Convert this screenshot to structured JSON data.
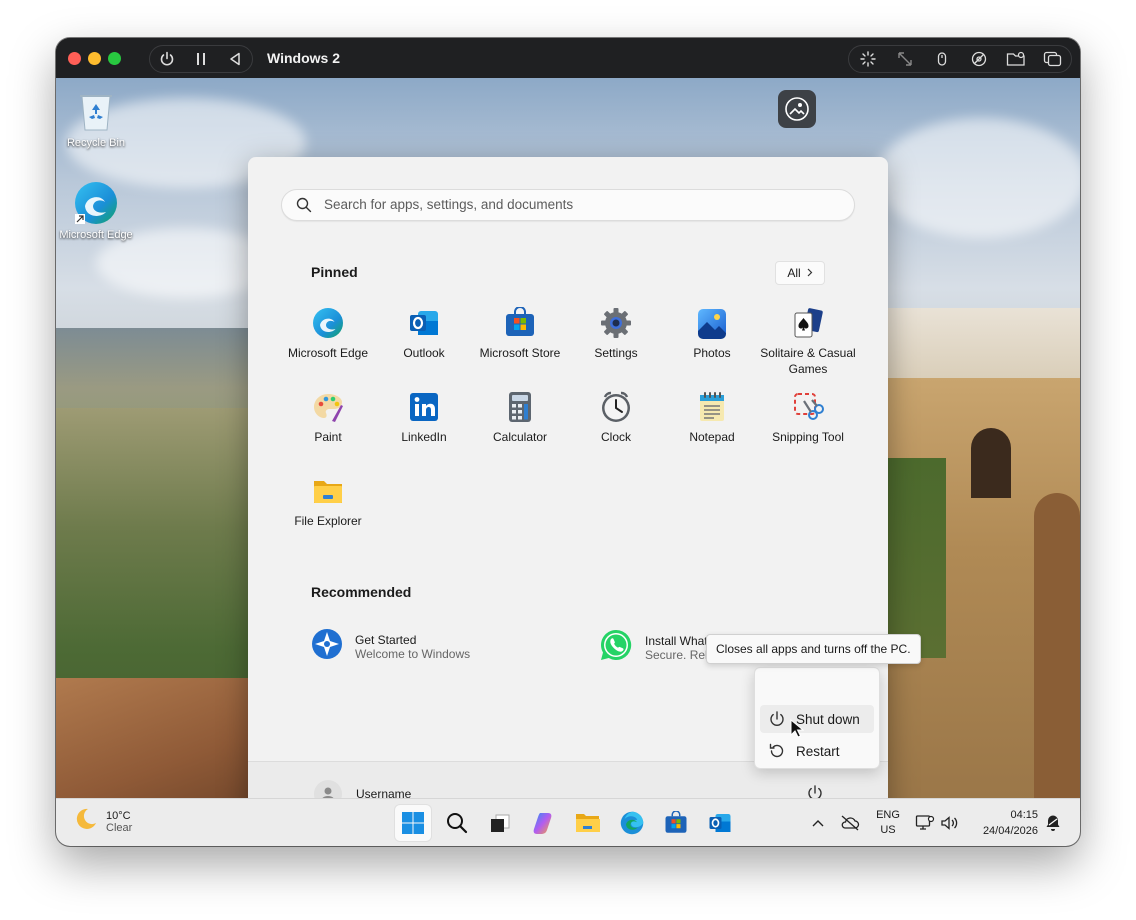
{
  "vm": {
    "title": "Windows 2",
    "toolbar_icons": [
      "power-icon",
      "pause-icon",
      "back-icon"
    ],
    "right_icons": [
      "spinner-icon",
      "resize-icon",
      "mouse-icon",
      "disc-icon",
      "folder-icon",
      "windows-icon"
    ]
  },
  "desktop": {
    "icons": [
      {
        "label": "Recycle Bin"
      },
      {
        "label": "Microsoft Edge"
      }
    ]
  },
  "start_menu": {
    "search": {
      "placeholder": "Search for apps, settings, and documents"
    },
    "pinned_title": "Pinned",
    "all_label": "All",
    "pinned_apps": [
      {
        "label": "Microsoft Edge"
      },
      {
        "label": "Outlook"
      },
      {
        "label": "Microsoft Store"
      },
      {
        "label": "Settings"
      },
      {
        "label": "Photos"
      },
      {
        "label": "Solitaire & Casual Games"
      },
      {
        "label": "Paint"
      },
      {
        "label": "LinkedIn"
      },
      {
        "label": "Calculator"
      },
      {
        "label": "Clock"
      },
      {
        "label": "Notepad"
      },
      {
        "label": "Snipping Tool"
      },
      {
        "label": "File Explorer"
      }
    ],
    "recommended_title": "Recommended",
    "recommended": [
      {
        "title": "Get Started",
        "subtitle": "Welcome to Windows"
      },
      {
        "title": "Install WhatsApp",
        "subtitle": "Secure. Reliable. Private."
      }
    ],
    "username": "Username",
    "power_menu": {
      "tooltip": "Closes all apps and turns off the PC.",
      "shutdown": "Shut down",
      "restart": "Restart"
    }
  },
  "taskbar": {
    "weather": {
      "temp": "10°C",
      "condition": "Clear"
    },
    "language": {
      "lang": "ENG",
      "region": "US"
    },
    "time": "04:15",
    "date": "24/04/2026"
  }
}
